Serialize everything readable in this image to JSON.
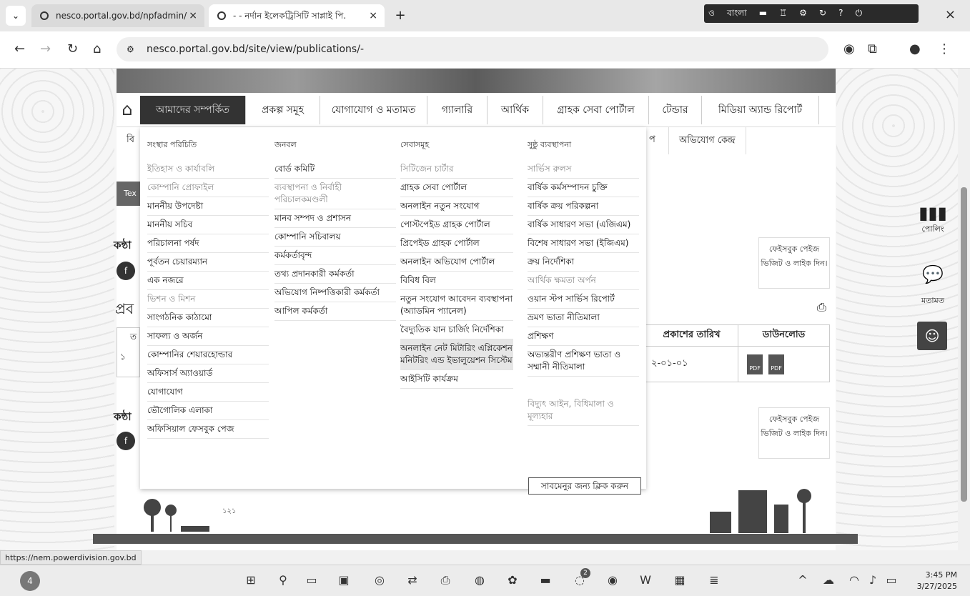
{
  "browser": {
    "tabs": [
      {
        "title": "nesco.portal.gov.bd/npfadmin/",
        "active": false
      },
      {
        "title": "- - নর্দান ইলেকট্রিসিটি সাপ্লাই পি.",
        "active": true
      }
    ],
    "new_tab": "+",
    "close_window": "×",
    "url": "nesco.portal.gov.bd/site/view/publications/-",
    "ext_lang": "বাংলা",
    "ext_icon_a": "ও"
  },
  "site": {
    "menu": [
      "আমাদের সম্পর্কিত",
      "প্রকল্প সমূহ",
      "যোগাযোগ ও মতামত",
      "গ্যালারি",
      "আর্থিক",
      "গ্রাহক সেবা পোর্টাল",
      "টেন্ডার",
      "মিডিয়া অ্যান্ড রিপোর্ট"
    ],
    "row2_left": "বি",
    "row2_right_a": "প",
    "row2_right_b": "অভিযোগ কেন্দ্র",
    "mega": {
      "col1": {
        "heading": "সংস্থার পরিচিতি",
        "items": [
          {
            "t": "ইতিহাস ও কার্যাবলি",
            "s": "gray"
          },
          {
            "t": "কোম্পানি প্রোফাইল",
            "s": "gray"
          },
          {
            "t": "মাননীয় উপদেষ্টা",
            "s": ""
          },
          {
            "t": "মাননীয় সচিব",
            "s": ""
          },
          {
            "t": "পরিচালনা পর্ষদ",
            "s": ""
          },
          {
            "t": "পূর্বতন চেয়ারম্যান",
            "s": ""
          },
          {
            "t": "এক নজরে",
            "s": ""
          },
          {
            "t": "ভিশন ও মিশন",
            "s": "gray"
          },
          {
            "t": "সাংগঠনিক কাঠামো",
            "s": ""
          },
          {
            "t": "সাফল্য ও অর্জন",
            "s": ""
          },
          {
            "t": "কোম্পানির শেয়ারহোল্ডার",
            "s": ""
          },
          {
            "t": "অফিসার্স অ্যাওয়ার্ড",
            "s": ""
          },
          {
            "t": "যোগাযোগ",
            "s": ""
          },
          {
            "t": "ভৌগোলিক এলাকা",
            "s": ""
          },
          {
            "t": "অফিসিয়াল ফেসবুক পেজ",
            "s": ""
          }
        ]
      },
      "col2": {
        "heading": "জনবল",
        "items": [
          {
            "t": "বোর্ড কমিটি",
            "s": ""
          },
          {
            "t": "ব্যবস্থাপনা ও নির্বাহী পরিচালকমণ্ডলী",
            "s": "gray"
          },
          {
            "t": "মানব সম্পদ ও প্রশাসন",
            "s": ""
          },
          {
            "t": "কোম্পানি সচিবালয়",
            "s": ""
          },
          {
            "t": "কর্মকর্তাবৃন্দ",
            "s": ""
          },
          {
            "t": "তথ্য প্রদানকারী কর্মকর্তা",
            "s": ""
          },
          {
            "t": "অভিযোগ নিষ্পত্তিকারী কর্মকর্তা",
            "s": ""
          },
          {
            "t": "আপিল কর্মকর্তা",
            "s": ""
          }
        ]
      },
      "col3": {
        "heading": "সেবাসমূহ",
        "items": [
          {
            "t": "সিটিজেন চার্টার",
            "s": "gray"
          },
          {
            "t": "গ্রাহক সেবা পোর্টাল",
            "s": ""
          },
          {
            "t": "অনলাইন নতুন সংযোগ",
            "s": ""
          },
          {
            "t": "পোস্টপেইড গ্রাহক পোর্টাল",
            "s": ""
          },
          {
            "t": "প্রিপেইড গ্রাহক পোর্টাল",
            "s": ""
          },
          {
            "t": "অনলাইন অভিযোগ পোর্টাল",
            "s": ""
          },
          {
            "t": "বিবিধ বিল",
            "s": ""
          },
          {
            "t": "নতুন সংযোগ আবেদন ব্যবস্থাপনা (অ্যাডমিন প্যানেল)",
            "s": ""
          },
          {
            "t": "বৈদ্যুতিক যান চার্জিং নির্দেশিকা",
            "s": ""
          },
          {
            "t": "অনলাইন নেট মিটারিং এপ্লিকেশন মনিটরিং এন্ড ইভালুয়েশন সিস্টেম",
            "s": "hl"
          },
          {
            "t": "আইসিটি কার্যক্রম",
            "s": ""
          }
        ]
      },
      "col4": {
        "heading": "সুষ্ঠু ব্যবস্থাপনা",
        "items": [
          {
            "t": "সার্ভিস রুলস",
            "s": "gray"
          },
          {
            "t": "বার্ষিক কর্মসম্পাদন চুক্তি",
            "s": ""
          },
          {
            "t": "বার্ষিক ক্রয় পরিকল্পনা",
            "s": ""
          },
          {
            "t": "বার্ষিক সাধারণ সভা (এজিএম)",
            "s": ""
          },
          {
            "t": "বিশেষ সাধারণ সভা (ইজিএম)",
            "s": ""
          },
          {
            "t": "ক্রয় নির্দেশিকা",
            "s": ""
          },
          {
            "t": "আর্থিক ক্ষমতা অর্পন",
            "s": "gray"
          },
          {
            "t": "ওয়ান স্টপ সার্ভিস রিপোর্ট",
            "s": ""
          },
          {
            "t": "ভ্রমণ ভাতা নীতিমালা",
            "s": ""
          },
          {
            "t": "প্রশিক্ষণ",
            "s": ""
          },
          {
            "t": "অভ্যন্তরীণ প্রশিক্ষণ ভাতা ও সম্মানী নীতিমালা",
            "s": ""
          },
          {
            "t": "",
            "s": ""
          },
          {
            "t": "বিদ্যুৎ আইন, বিধিমালা ও মূল্যহার",
            "s": "gray"
          }
        ]
      }
    },
    "tooltip": "সাবমেনুর জন্য ক্লিক করুন",
    "side_text": "Tex",
    "left_label_1": "কন্ঠা",
    "left_label_2": "প্রব",
    "left_label_3": "কন্ঠা",
    "table_left_head": "ত",
    "table_left_row": "১",
    "table": {
      "date_head": "প্রকাশের তারিখ",
      "download_head": "ডাউনলোড",
      "date_val": "২-০১-০১",
      "pdf": "PDF"
    },
    "fb_box": "ফেইসবুক পেইজ ভিজিট ও লাইক দিন।",
    "footer_scribble": "১২১"
  },
  "side_widgets": {
    "poll": "পোলিং",
    "feedback": "মতামত"
  },
  "status_url": "https://nem.powerdivision.gov.bd",
  "taskbar": {
    "badge": "4",
    "time": "3:45 PM",
    "date": "3/27/2025",
    "chat_badge": "2"
  }
}
